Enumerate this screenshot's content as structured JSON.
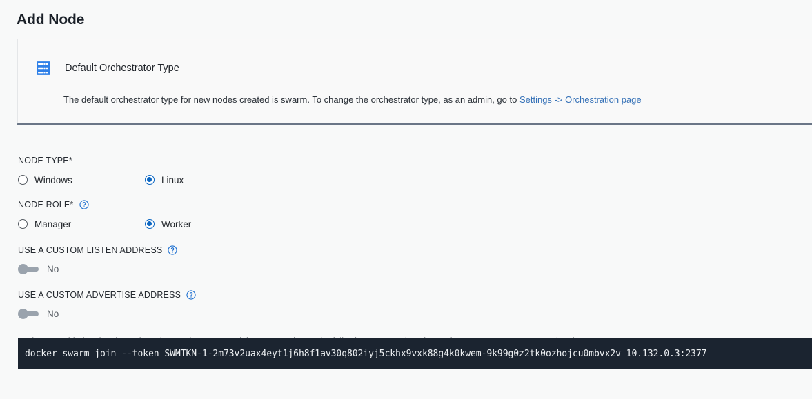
{
  "page": {
    "title": "Add Node"
  },
  "info_card": {
    "icon": "server-rack-icon",
    "title": "Default Orchestrator Type",
    "description_before_link": "The default orchestrator type for new nodes created is swarm. To change the orchestrator type, as an admin, go to ",
    "link_text": "Settings -> Orchestration page"
  },
  "form": {
    "node_type": {
      "label": "NODE TYPE*",
      "options": [
        {
          "label": "Windows",
          "checked": false
        },
        {
          "label": "Linux",
          "checked": true
        }
      ]
    },
    "node_role": {
      "label": "NODE ROLE*",
      "help_icon": "help-circle-icon",
      "options": [
        {
          "label": "Manager",
          "checked": false
        },
        {
          "label": "Worker",
          "checked": true
        }
      ]
    },
    "custom_listen_address": {
      "label": "USE A CUSTOM LISTEN ADDRESS",
      "help_icon": "help-circle-icon",
      "value": "No",
      "on": false
    },
    "custom_advertise_address": {
      "label": "USE A CUSTOM ADVERTISE ADDRESS",
      "help_icon": "help-circle-icon",
      "value": "No",
      "on": false
    },
    "note": "Nodes are added to the cluster by using Docker's 'swarm join' command. Use the following command on the engine you want to connect to the cluster."
  },
  "command": {
    "text": "docker swarm join --token SWMTKN-1-2m73v2uax4eyt1j6h8f1av30q802iyj5ckhx9vxk88g4k0kwem-9k99g0z2tk0ozhojcu0mbvx2v 10.132.0.3:2377"
  },
  "colors": {
    "accent": "#0a66c2",
    "link": "#3571b7",
    "card_border_bottom": "#6a7687",
    "code_bg": "#1b2430",
    "page_bg": "#f8f9f9",
    "toggle_off": "#9aa3ad"
  }
}
